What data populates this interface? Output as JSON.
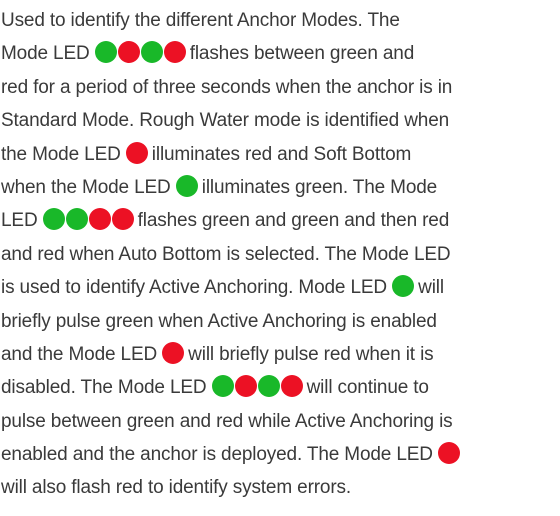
{
  "colors": {
    "text": "#3a3a3a",
    "led_green": "#19b829",
    "led_red": "#ec1124"
  },
  "icons": {
    "led": "led-circle-icon"
  },
  "paragraph": {
    "lines": [
      {
        "segments": [
          {
            "text": "Used to identify the different Anchor Modes. The"
          }
        ]
      },
      {
        "segments": [
          {
            "text": "Mode LED "
          },
          {
            "leds": [
              "green",
              "red",
              "green",
              "red"
            ]
          },
          {
            "text": "flashes between green and"
          }
        ]
      },
      {
        "segments": [
          {
            "text": "red for a period of three seconds when the anchor is in"
          }
        ]
      },
      {
        "segments": [
          {
            "text": "Standard Mode. Rough Water mode is identified when"
          }
        ]
      },
      {
        "segments": [
          {
            "text": "the Mode LED "
          },
          {
            "leds": [
              "red"
            ]
          },
          {
            "text": "illuminates red and Soft Bottom"
          }
        ]
      },
      {
        "segments": [
          {
            "text": "when the Mode LED "
          },
          {
            "leds": [
              "green"
            ]
          },
          {
            "text": "illuminates green. The Mode"
          }
        ]
      },
      {
        "segments": [
          {
            "text": "LED "
          },
          {
            "leds": [
              "green",
              "green",
              "red",
              "red"
            ]
          },
          {
            "text": "flashes green and green and then red"
          }
        ]
      },
      {
        "segments": [
          {
            "text": "and red when Auto Bottom is selected. The Mode LED"
          }
        ]
      },
      {
        "segments": [
          {
            "text": "is used to identify Active Anchoring. Mode LED "
          },
          {
            "leds": [
              "green"
            ]
          },
          {
            "text": "will"
          }
        ]
      },
      {
        "segments": [
          {
            "text": "briefly pulse green when Active Anchoring is enabled"
          }
        ]
      },
      {
        "segments": [
          {
            "text": "and the Mode LED "
          },
          {
            "leds": [
              "red"
            ]
          },
          {
            "text": "will briefly pulse red when it is"
          }
        ]
      },
      {
        "segments": [
          {
            "text": "disabled. The Mode LED "
          },
          {
            "leds": [
              "green",
              "red",
              "green",
              "red"
            ]
          },
          {
            "text": "will continue to"
          }
        ]
      },
      {
        "segments": [
          {
            "text": "pulse between green and red while Active Anchoring is"
          }
        ]
      },
      {
        "segments": [
          {
            "text": "enabled and the anchor is deployed. The Mode LED "
          },
          {
            "leds": [
              "red"
            ]
          }
        ]
      },
      {
        "segments": [
          {
            "text": "will also flash red to identify system errors."
          }
        ]
      }
    ]
  }
}
